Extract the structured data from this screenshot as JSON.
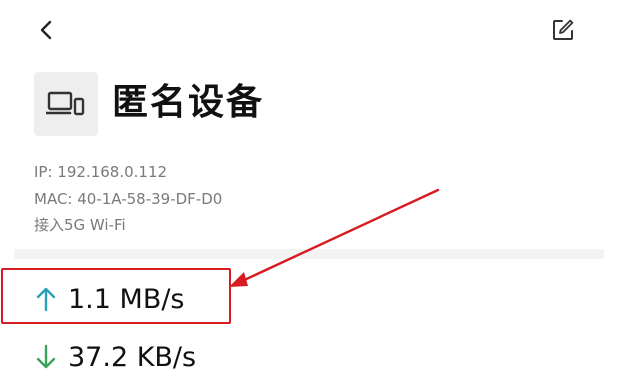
{
  "header": {
    "back_icon": "chevron-left-icon",
    "edit_icon": "edit-icon"
  },
  "device": {
    "icon": "laptop-phone-icon",
    "name": "匿名设备",
    "ip": "IP: 192.168.0.112",
    "mac": "MAC: 40-1A-58-39-DF-D0",
    "connection": "接入5G Wi-Fi"
  },
  "traffic": {
    "upload": {
      "icon": "arrow-up-icon",
      "value": "1.1 MB/s",
      "color": "#2aa0b6"
    },
    "download": {
      "icon": "arrow-down-icon",
      "value": "37.2 KB/s",
      "color": "#3aa35a"
    }
  },
  "annotation": {
    "color": "#d81b20"
  }
}
